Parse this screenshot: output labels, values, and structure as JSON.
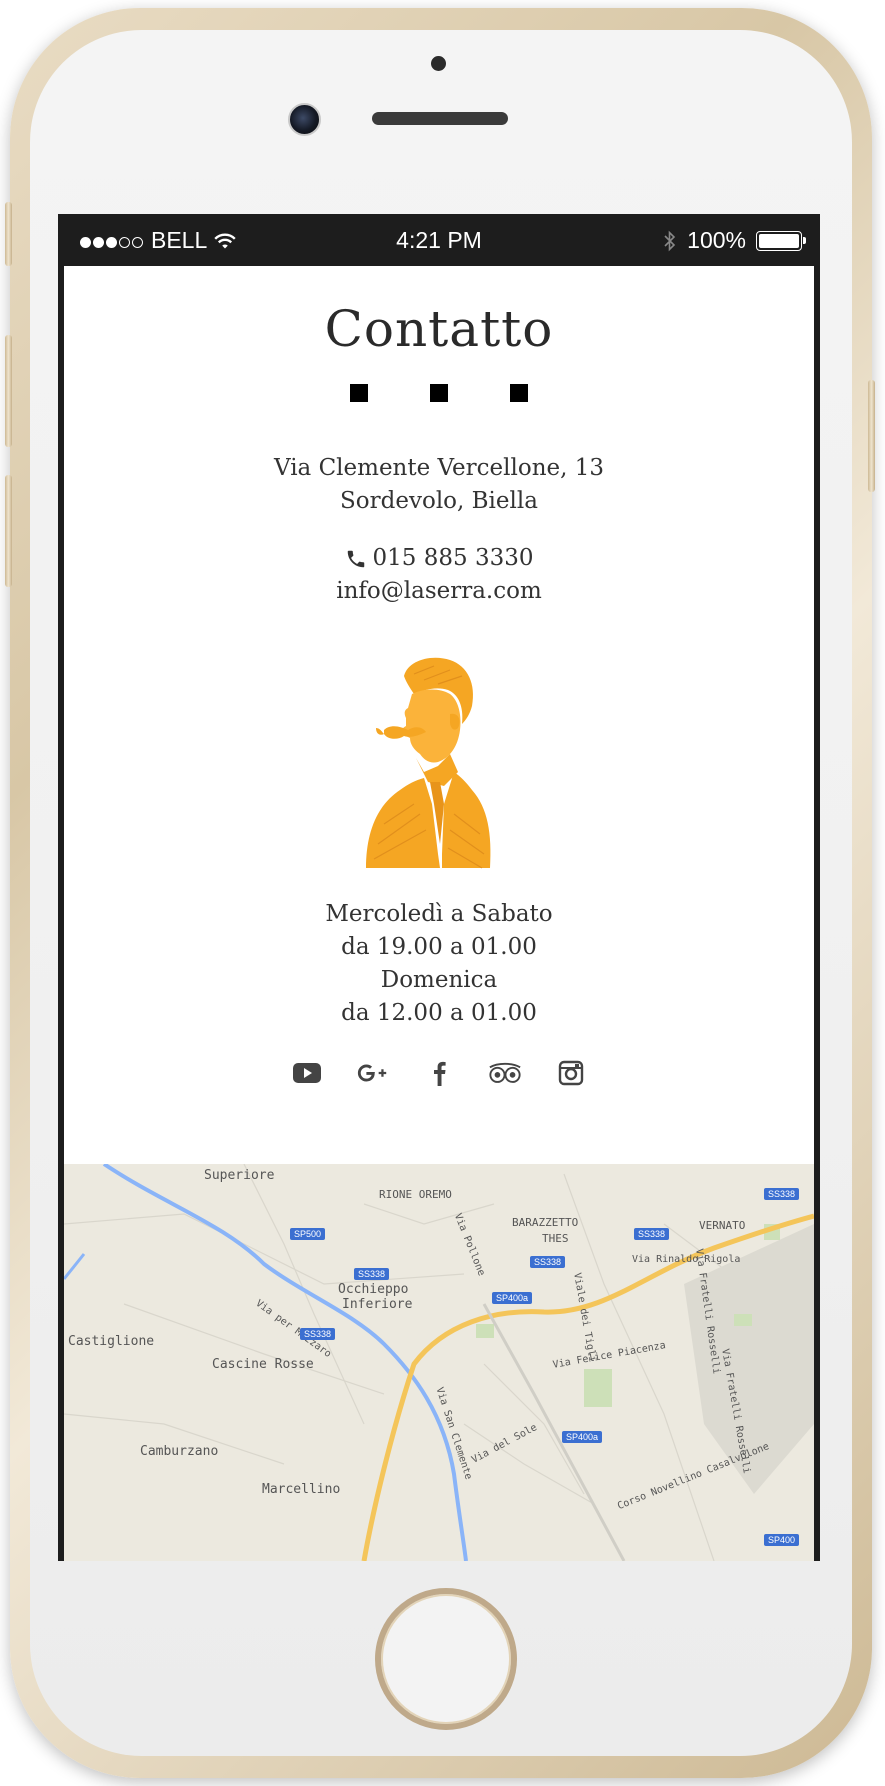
{
  "status_bar": {
    "carrier": "BELL",
    "time": "4:21 PM",
    "battery": "100%"
  },
  "page": {
    "title": "Contatto",
    "address": {
      "line1": "Via Clemente Vercellone, 13",
      "line2": "Sordevolo, Biella"
    },
    "contact": {
      "phone": "015 885 3330",
      "email": "info@laserra.com"
    },
    "hours": {
      "line1": "Mercoledì a Sabato",
      "line2": "da 19.00 a 01.00",
      "line3": "Domenica",
      "line4": "da 12.00 a 01.00"
    },
    "social_icons": [
      "youtube-icon",
      "google-plus-icon",
      "facebook-icon",
      "tripadvisor-icon",
      "instagram-icon"
    ],
    "accent_color": "#f5a623"
  },
  "map": {
    "labels": {
      "superiore": "Superiore",
      "rione_oremo": "RIONE OREMO",
      "barazzetto": "BARAZZETTO",
      "thes": "THES",
      "vernato": "VERNATO",
      "occhieppo": "Occhieppo",
      "inferiore": "Inferiore",
      "castiglione": "Castiglione",
      "cascine_rosse": "Cascine Rosse",
      "camburzano": "Camburzano",
      "marcellino": "Marcellino",
      "via_mazzaro": "Via per Mazzaro",
      "via_pollone": "Via Pollone",
      "via_tigli": "Viale dei Tigli",
      "via_rinaldo": "Via Rinaldo Rigola",
      "via_felice": "Via Felice Piacenza",
      "via_san_clemente": "Via San Clemente",
      "via_del_sole": "Via del Sole",
      "via_fratelli_rosselli": "Via Fratelli Rosselli",
      "via_fratelli_rosselli_2": "Via Fratelli Rosselli",
      "corso_novellino": "Corso Novellino Casalvolone"
    },
    "road_tags": {
      "sp500": "SP500",
      "ss338_a": "SS338",
      "ss338_b": "SS338",
      "ss338_c": "SS338",
      "ss338_d": "SS338",
      "ss338_e": "SS338",
      "sp400a": "SP400a",
      "sp400a_2": "SP400a",
      "sp400": "SP400"
    }
  }
}
